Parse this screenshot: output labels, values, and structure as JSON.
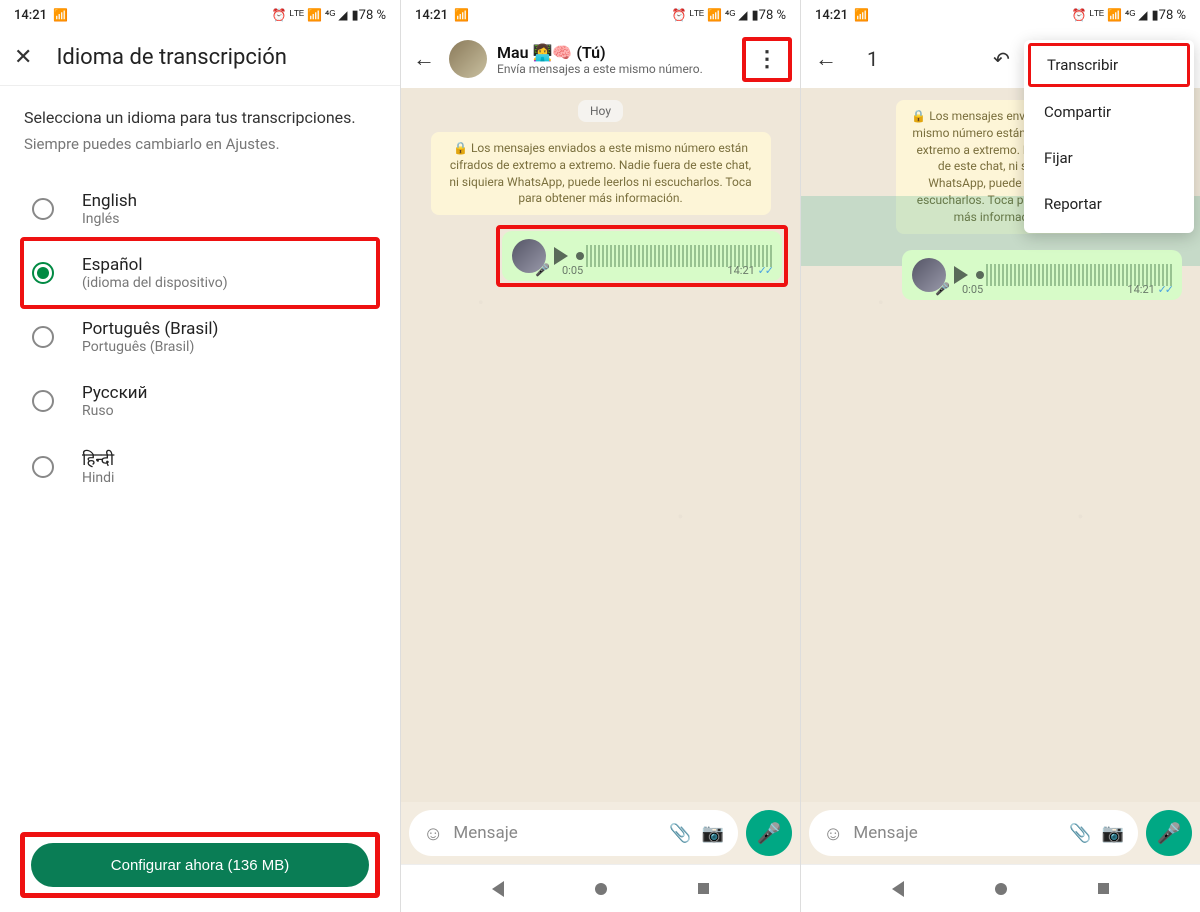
{
  "status": {
    "time": "14:21",
    "sim": "📶",
    "icons": "⏰ ᴸᵀᴱ 📶 ⁴ᴳ ◢",
    "battery": "▮78 %"
  },
  "phone1": {
    "title": "Idioma de transcripción",
    "primary": "Selecciona un idioma para tus transcripciones.",
    "secondary": "Siempre puedes cambiarlo en Ajustes.",
    "languages": [
      {
        "l1": "English",
        "l2": "Inglés",
        "selected": false
      },
      {
        "l1": "Español",
        "l2": "(idioma del dispositivo)",
        "selected": true,
        "highlight": true
      },
      {
        "l1": "Português (Brasil)",
        "l2": "Português (Brasil)",
        "selected": false
      },
      {
        "l1": "Русский",
        "l2": "Ruso",
        "selected": false
      },
      {
        "l1": "हिन्दी",
        "l2": "Hindi",
        "selected": false
      }
    ],
    "button": "Configurar ahora (136 MB)"
  },
  "chat": {
    "name": "Mau 👩‍💻🧠 (Tú)",
    "subtitle": "Envía mensajes a este mismo número.",
    "date": "Hoy",
    "encrypt": "🔒 Los mensajes enviados a este mismo número están cifrados de extremo a extremo. Nadie fuera de este chat, ni siquiera WhatsApp, puede leerlos ni escucharlos. Toca para obtener más información.",
    "voice_duration": "0:05",
    "voice_time": "14:21",
    "placeholder": "Mensaje"
  },
  "phone3": {
    "selected_count": "1",
    "encrypt_partial": "🔒 Los mensajes enviados a este mismo número están cifrados de extremo a extremo. Nadie fuera de este chat, ni siquiera WhatsApp, puede leerlos ni escucharlos. Toca para obtener más información.",
    "menu": {
      "transcribir": "Transcribir",
      "compartir": "Compartir",
      "fijar": "Fijar",
      "reportar": "Reportar"
    }
  }
}
